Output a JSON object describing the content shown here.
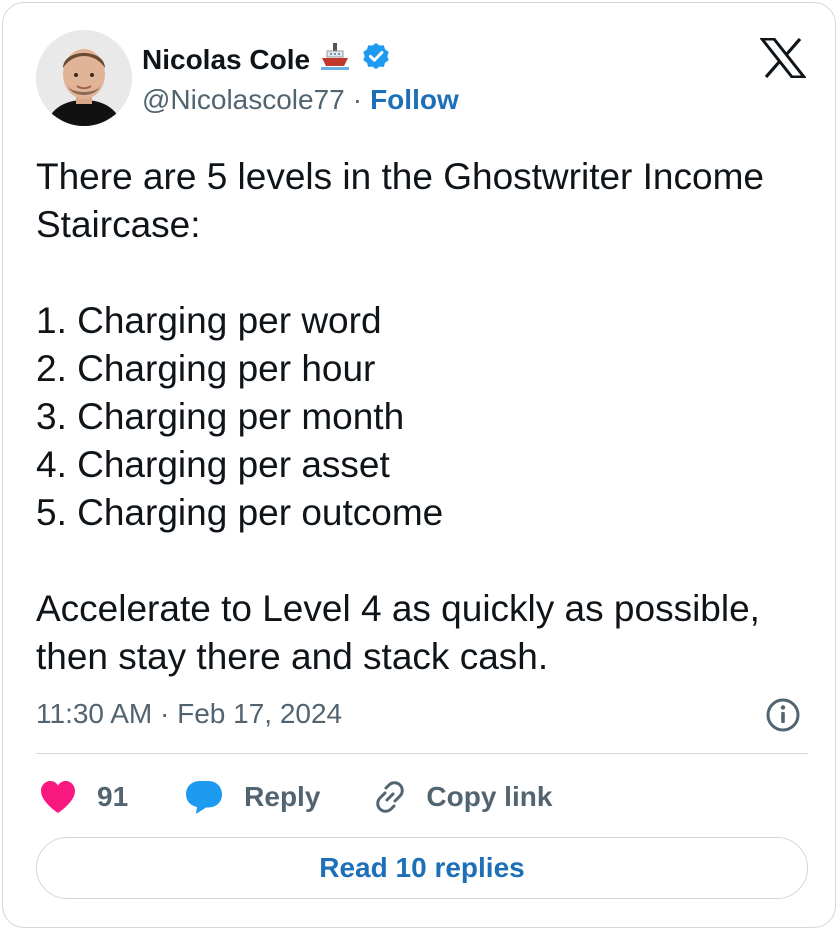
{
  "author": {
    "name": "Nicolas Cole",
    "name_emoji": "🚢",
    "handle": "@Nicolascole77",
    "separator": "·",
    "follow_label": "Follow"
  },
  "tweet": {
    "text": "There are 5 levels in the Ghostwriter Income Staircase:\n\n1. Charging per word\n2. Charging per hour\n3. Charging per month\n4. Charging per asset\n5. Charging per outcome\n\nAccelerate to Level 4 as quickly as possible, then stay there and stack cash.",
    "timestamp": "11:30 AM · Feb 17, 2024"
  },
  "actions": {
    "like_count": "91",
    "reply_label": "Reply",
    "copy_link_label": "Copy link"
  },
  "read_replies_label": "Read 10 replies",
  "colors": {
    "like": "#f91880",
    "reply": "#1d9bf0",
    "link_blue": "#1d70b8",
    "verified": "#1d9bf0",
    "muted": "#536471"
  },
  "icons": [
    "ship-emoji-icon",
    "verified-badge-icon",
    "x-logo-icon",
    "info-icon",
    "heart-icon",
    "reply-bubble-icon",
    "link-icon"
  ]
}
